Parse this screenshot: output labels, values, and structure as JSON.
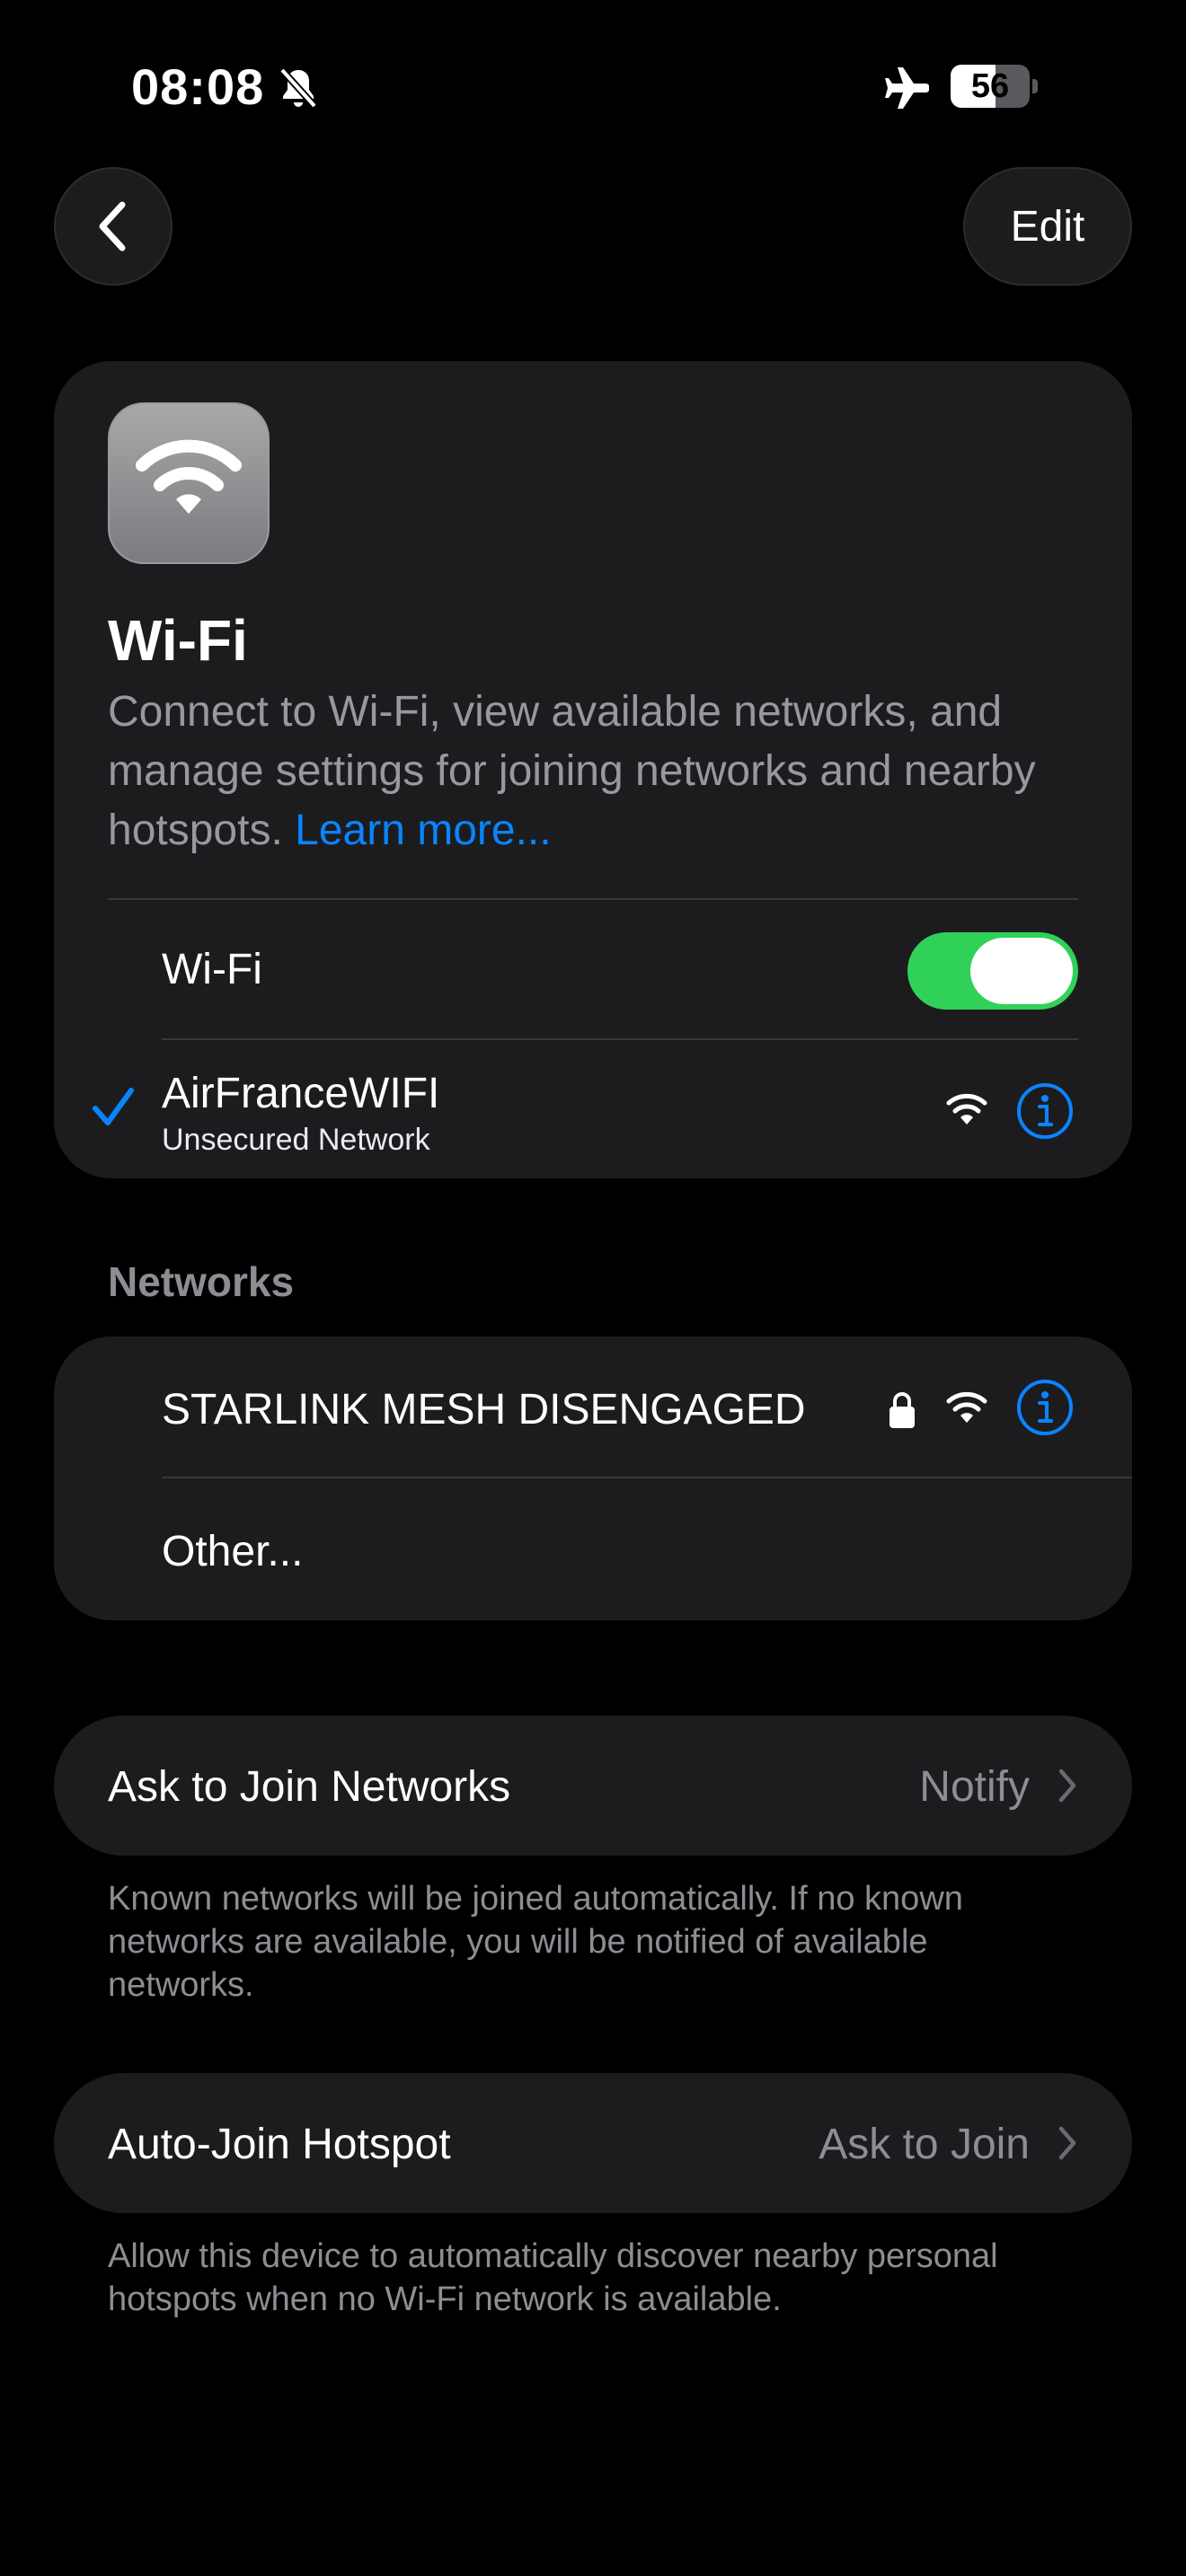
{
  "status_bar": {
    "time": "08:08",
    "battery_level": "56",
    "icons": [
      "bell-slash-icon",
      "airplane-icon",
      "battery-icon"
    ]
  },
  "nav": {
    "back_icon": "chevron-left-icon",
    "edit_label": "Edit"
  },
  "header_card": {
    "app_icon": "wifi-icon",
    "title": "Wi-Fi",
    "description": "Connect to Wi-Fi, view available networks, and manage settings for joining networks and nearby hotspots. ",
    "learn_more": "Learn more...",
    "wifi_toggle_label": "Wi-Fi",
    "wifi_toggle_on": true,
    "connected_network": {
      "name": "AirFranceWIFI",
      "subtitle": "Unsecured Network",
      "icons": [
        "checkmark-icon",
        "wifi-signal-icon",
        "info-icon"
      ]
    }
  },
  "networks": {
    "header": "Networks",
    "items": [
      {
        "name": "STARLINK MESH DISENGAGED",
        "icons": [
          "lock-icon",
          "wifi-signal-icon",
          "info-icon"
        ]
      },
      {
        "name": "Other..."
      }
    ]
  },
  "ask_to_join": {
    "label": "Ask to Join Networks",
    "value": "Notify",
    "footnote": "Known networks will be joined automatically. If no known networks are available, you will be notified of available networks."
  },
  "auto_join_hotspot": {
    "label": "Auto-Join Hotspot",
    "value": "Ask to Join",
    "footnote": "Allow this device to automatically discover nearby personal hotspots when no Wi-Fi network is available."
  },
  "colors": {
    "background": "#000000",
    "card": "#1c1c1e",
    "accent": "#0a84ff",
    "toggle_on": "#30d158",
    "secondary_text": "#8d8d93"
  }
}
